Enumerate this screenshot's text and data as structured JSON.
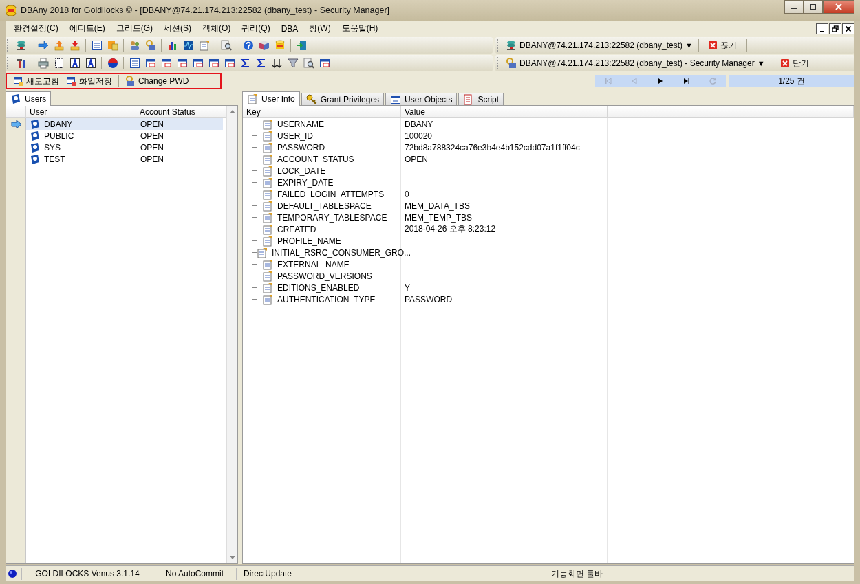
{
  "window": {
    "title": "DBAny 2018 for Goldilocks © - [DBANY@74.21.174.213:22582 (dbany_test) - Security Manager]"
  },
  "menu": [
    "환경설정(C)",
    "에디트(E)",
    "그리드(G)",
    "세션(S)",
    "객체(O)",
    "쿼리(Q)",
    "DBA",
    "창(W)",
    "도움말(H)"
  ],
  "connection_bar": {
    "label": "DBANY@74.21.174.213:22582 (dbany_test)",
    "dropdown": "▼",
    "action": "끊기"
  },
  "window_bar": {
    "label": "DBANY@74.21.174.213:22582 (dbany_test) - Security Manager",
    "dropdown": "▼",
    "action": "닫기"
  },
  "actions": [
    "새로고침",
    "화일저장",
    "Change PWD"
  ],
  "navigator": {
    "buttons": [
      {
        "kind": "first",
        "disabled": true
      },
      {
        "kind": "prev",
        "disabled": true
      },
      {
        "kind": "next",
        "disabled": false
      },
      {
        "kind": "last",
        "disabled": false
      },
      {
        "kind": "refresh",
        "disabled": true
      }
    ],
    "count": "1/25 건"
  },
  "left_tabs": [
    {
      "label": "Users",
      "selected": true
    }
  ],
  "users_table": {
    "columns": [
      "User",
      "Account Status"
    ],
    "rows": [
      {
        "user": "DBANY",
        "status": "OPEN",
        "selected": true
      },
      {
        "user": "PUBLIC",
        "status": "OPEN",
        "selected": false
      },
      {
        "user": "SYS",
        "status": "OPEN",
        "selected": false
      },
      {
        "user": "TEST",
        "status": "OPEN",
        "selected": false
      }
    ]
  },
  "right_tabs": [
    {
      "label": "User Info",
      "selected": true
    },
    {
      "label": "Grant Privileges",
      "selected": false
    },
    {
      "label": "User Objects",
      "selected": false
    },
    {
      "label": "Script",
      "selected": false
    }
  ],
  "info_table": {
    "columns": [
      "Key",
      "Value"
    ],
    "rows": [
      {
        "key": "USERNAME",
        "value": "DBANY"
      },
      {
        "key": "USER_ID",
        "value": "100020"
      },
      {
        "key": "PASSWORD",
        "value": "72bd8a788324ca76e3b4e4b152cdd07a1f1ff04c"
      },
      {
        "key": "ACCOUNT_STATUS",
        "value": "OPEN"
      },
      {
        "key": "LOCK_DATE",
        "value": ""
      },
      {
        "key": "EXPIRY_DATE",
        "value": ""
      },
      {
        "key": "FAILED_LOGIN_ATTEMPTS",
        "value": "0"
      },
      {
        "key": "DEFAULT_TABLESPACE",
        "value": "MEM_DATA_TBS"
      },
      {
        "key": "TEMPORARY_TABLESPACE",
        "value": "MEM_TEMP_TBS"
      },
      {
        "key": "CREATED",
        "value": "2018-04-26 오후 8:23:12"
      },
      {
        "key": "PROFILE_NAME",
        "value": ""
      },
      {
        "key": "INITIAL_RSRC_CONSUMER_GRO...",
        "value": ""
      },
      {
        "key": "EXTERNAL_NAME",
        "value": ""
      },
      {
        "key": "PASSWORD_VERSIONS",
        "value": ""
      },
      {
        "key": "EDITIONS_ENABLED",
        "value": "Y"
      },
      {
        "key": "AUTHENTICATION_TYPE",
        "value": "PASSWORD"
      }
    ]
  },
  "status_bar": [
    "GOLDILOCKS Venus 3.1.14",
    "No AutoCommit",
    "DirectUpdate",
    "기능화면 툴바"
  ]
}
